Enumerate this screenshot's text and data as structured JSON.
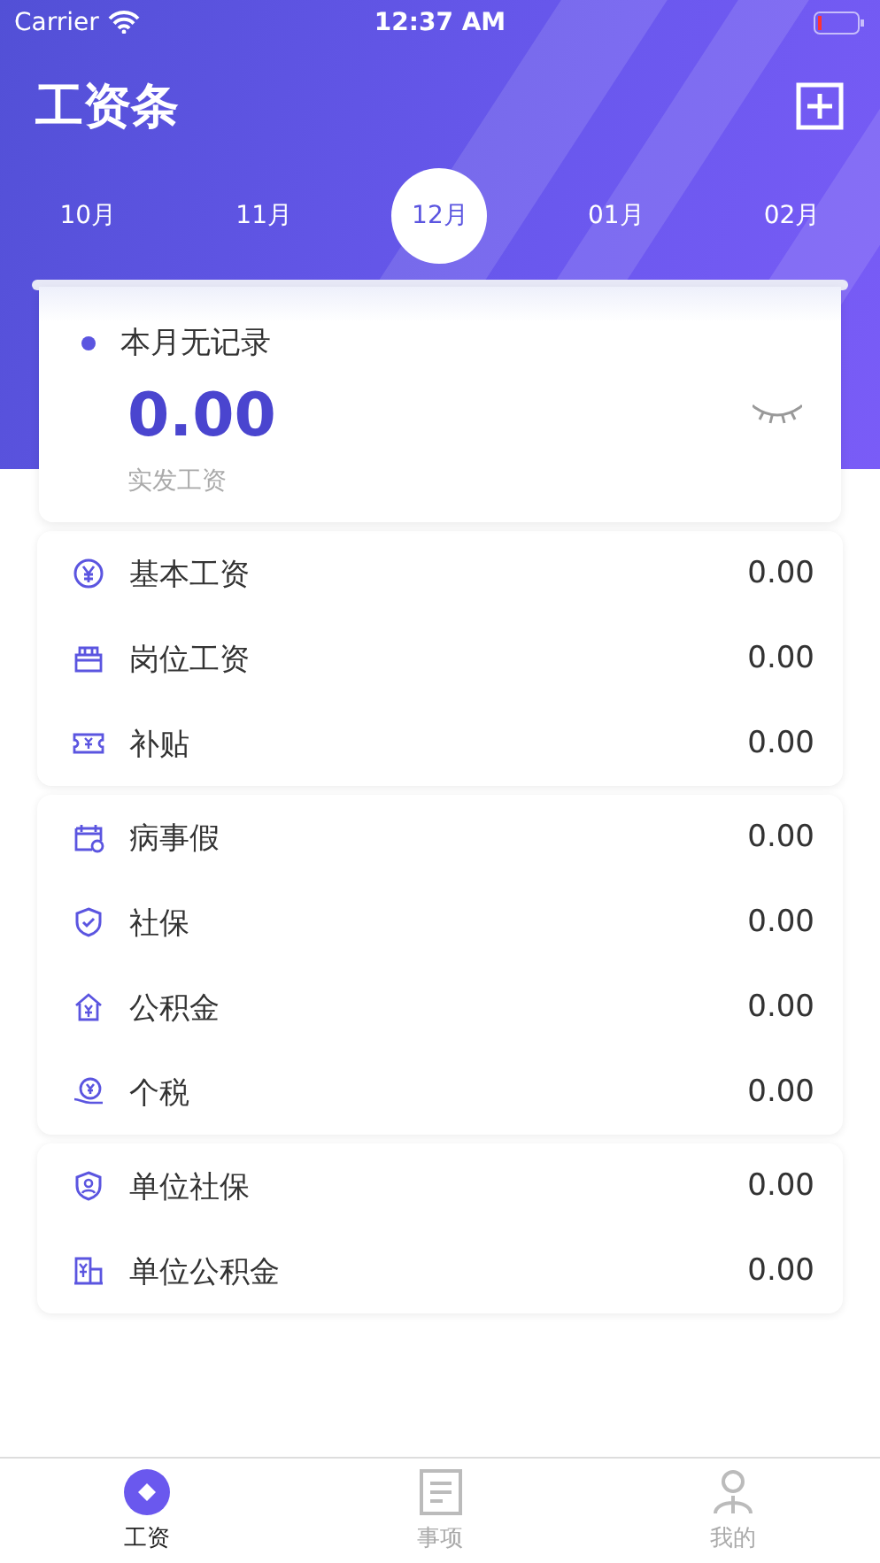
{
  "status_bar": {
    "carrier": "Carrier",
    "time": "12:37 AM"
  },
  "header": {
    "title": "工资条"
  },
  "months": [
    {
      "label": "10月",
      "selected": false
    },
    {
      "label": "11月",
      "selected": false
    },
    {
      "label": "12月",
      "selected": true
    },
    {
      "label": "01月",
      "selected": false
    },
    {
      "label": "02月",
      "selected": false
    }
  ],
  "summary": {
    "status": "本月无记录",
    "amount": "0.00",
    "caption": "实发工资"
  },
  "groups": [
    {
      "items": [
        {
          "label": "基本工资",
          "value": "0.00"
        },
        {
          "label": "岗位工资",
          "value": "0.00"
        },
        {
          "label": "补贴",
          "value": "0.00"
        }
      ]
    },
    {
      "items": [
        {
          "label": "病事假",
          "value": "0.00"
        },
        {
          "label": "社保",
          "value": "0.00"
        },
        {
          "label": "公积金",
          "value": "0.00"
        },
        {
          "label": "个税",
          "value": "0.00"
        }
      ]
    },
    {
      "items": [
        {
          "label": "单位社保",
          "value": "0.00"
        },
        {
          "label": "单位公积金",
          "value": "0.00"
        }
      ]
    }
  ],
  "tab_bar": [
    {
      "label": "工资",
      "selected": true
    },
    {
      "label": "事项",
      "selected": false
    },
    {
      "label": "我的",
      "selected": false
    }
  ]
}
